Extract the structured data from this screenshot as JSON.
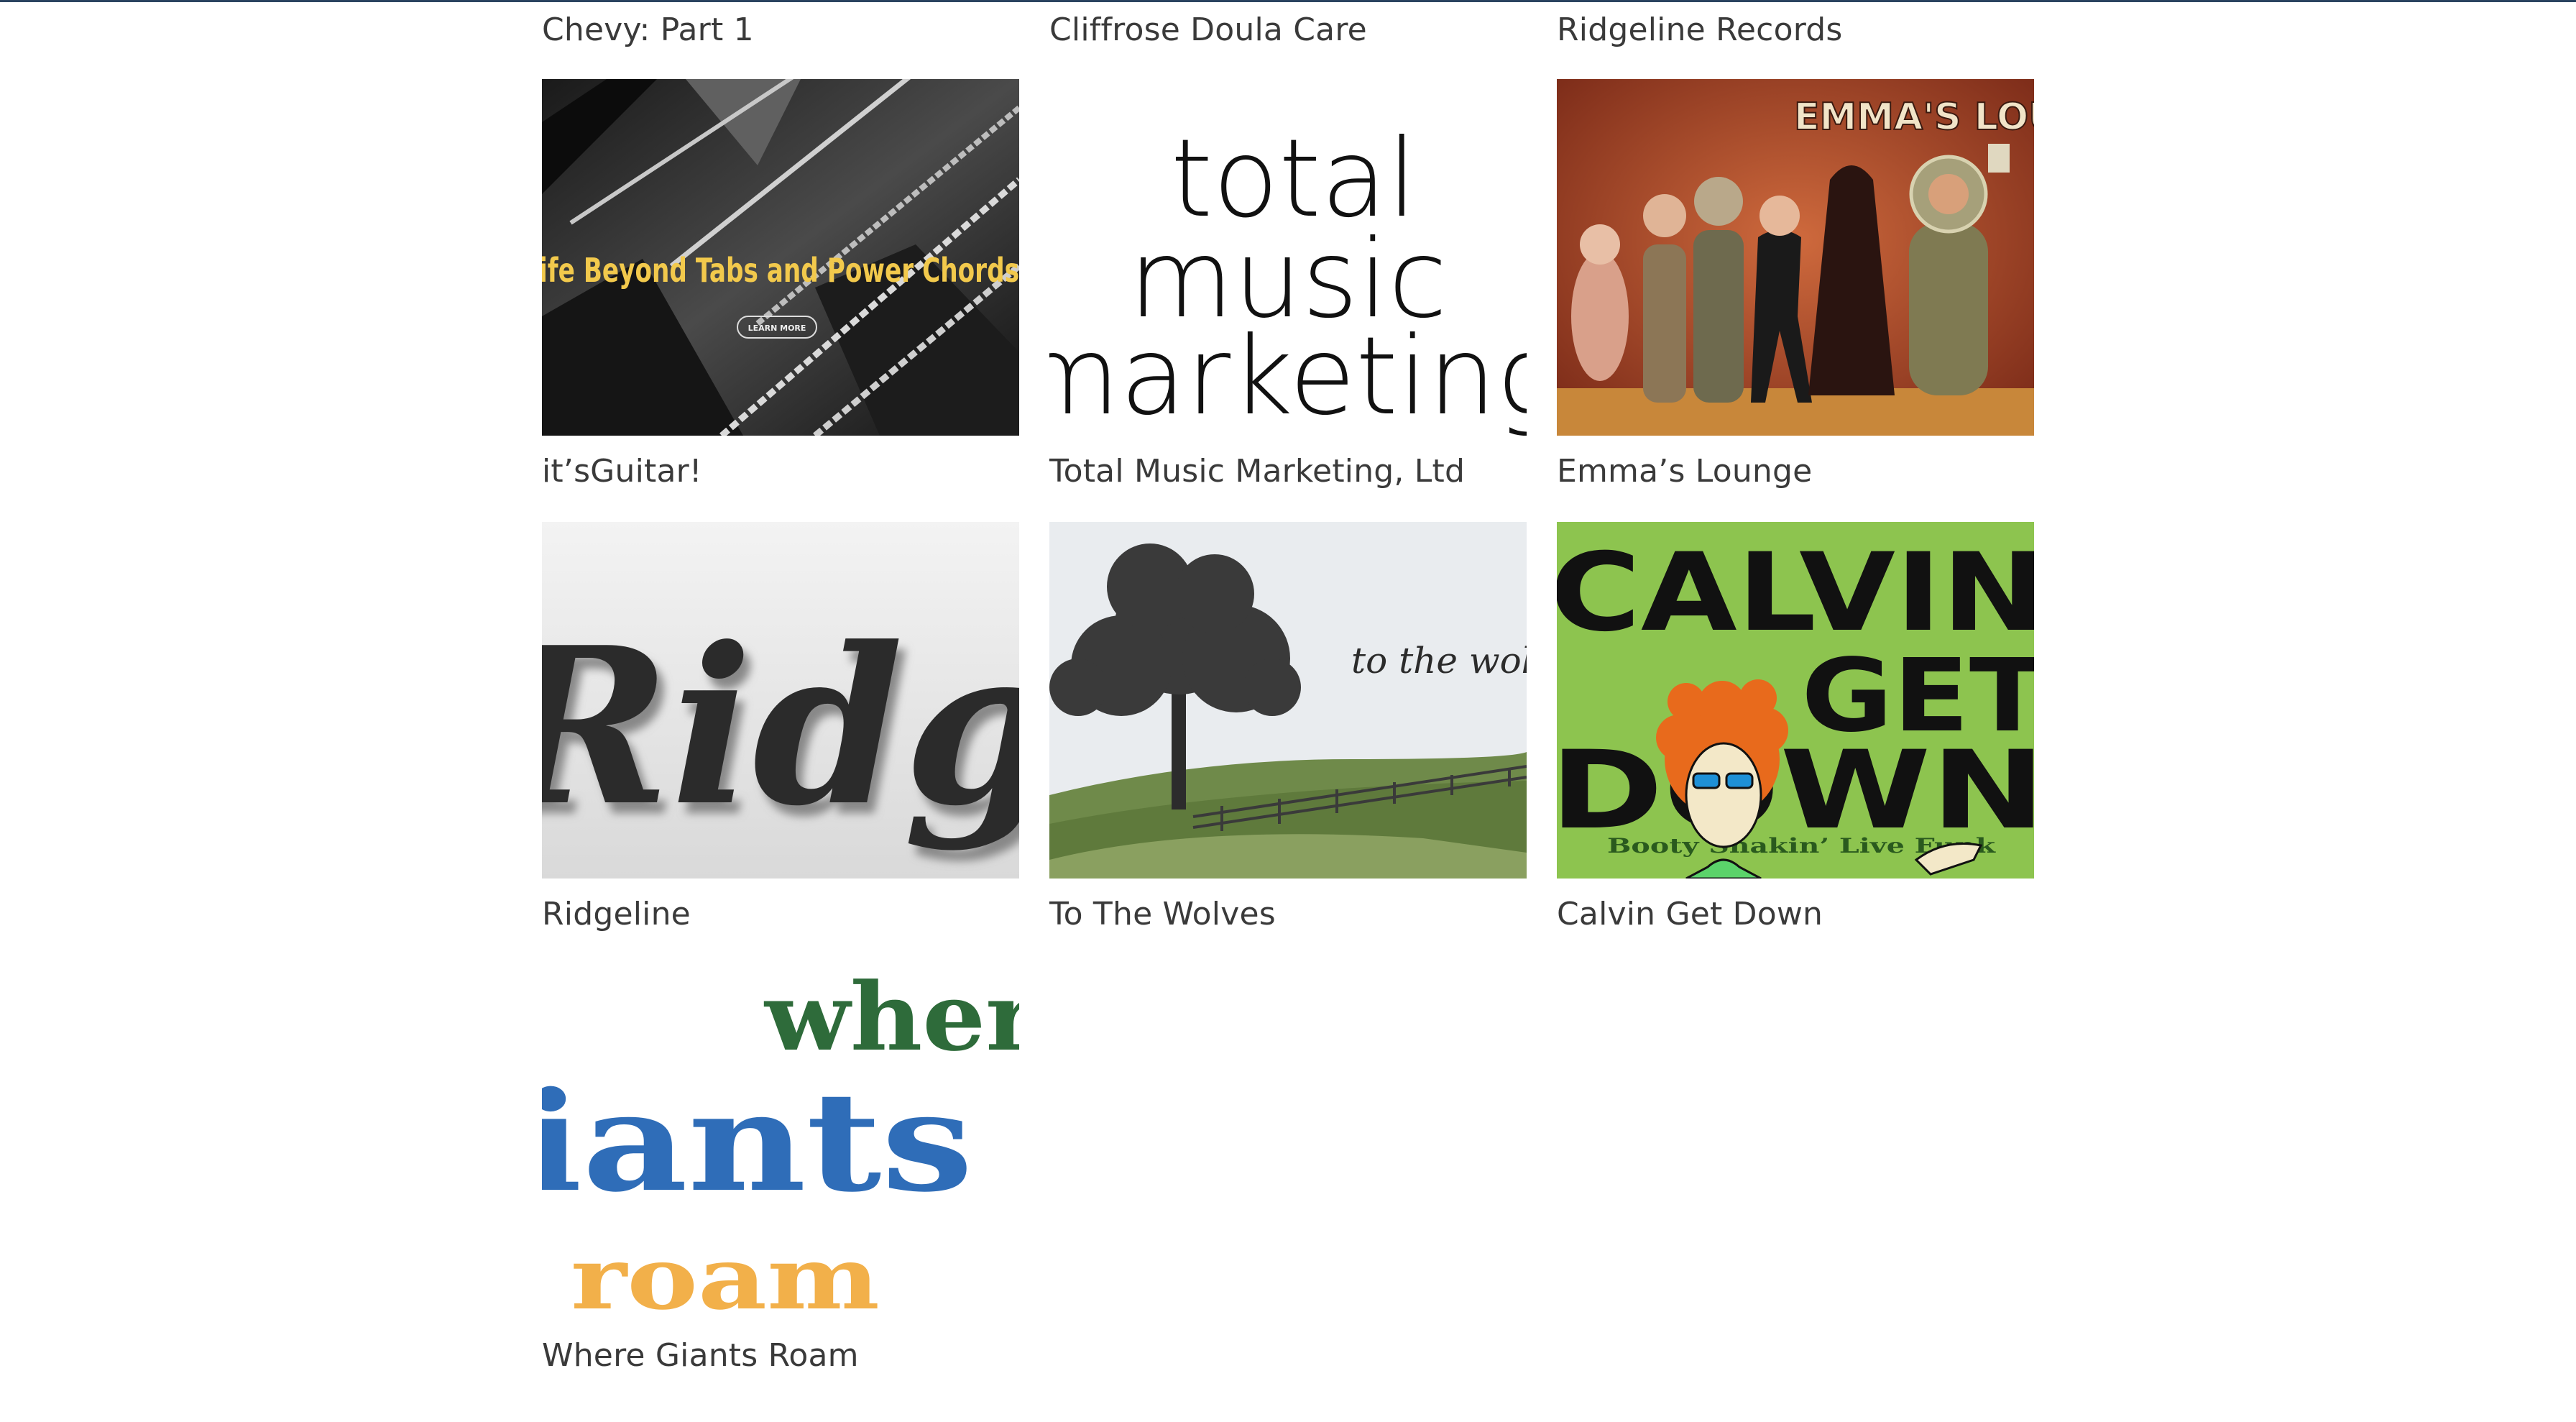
{
  "portfolio": {
    "top_row_labels": [
      "Chevy: Part 1",
      "Cliffrose Doula Care",
      "Ridgeline Records"
    ],
    "items": [
      {
        "label": "it’sGuitar!",
        "image_text": "ife Beyond Tabs and Power Chords",
        "image_button": "LEARN MORE",
        "icon": "guitar-strings-image"
      },
      {
        "label": "Total Music Marketing, Ltd",
        "image_lines": [
          "total",
          "music",
          "marketing"
        ],
        "icon": "text-logo-image"
      },
      {
        "label": "Emma’s Lounge",
        "image_text": "EMMA'S LOUNGE",
        "icon": "retro-poster-image"
      },
      {
        "label": "Ridgeline",
        "image_text": "Ridgel",
        "icon": "script-logo-image"
      },
      {
        "label": "To The Wolves",
        "image_text": "to the wolves",
        "icon": "tree-landscape-image"
      },
      {
        "label": "Calvin Get Down",
        "image_lines": [
          "CALVIN",
          "GET",
          "DOWN"
        ],
        "image_subtext": "Booty Shakin’ Live Funk",
        "icon": "cartoon-poster-image"
      },
      {
        "label": "Where Giants Roam",
        "image_lines": [
          "wher",
          "iants",
          "roam"
        ],
        "icon": "block-letter-logo-image"
      }
    ]
  },
  "colors": {
    "background": "#ffffff",
    "label_text": "#3a3a3a",
    "top_border": "#2a4360",
    "guitar_text": "#f2c94c",
    "emma_bg": "#b44a2a",
    "calvin_bg": "#8dc44f",
    "giants_green": "#2e6b3a",
    "giants_blue": "#2f6db8",
    "giants_orange": "#f2b04a"
  }
}
